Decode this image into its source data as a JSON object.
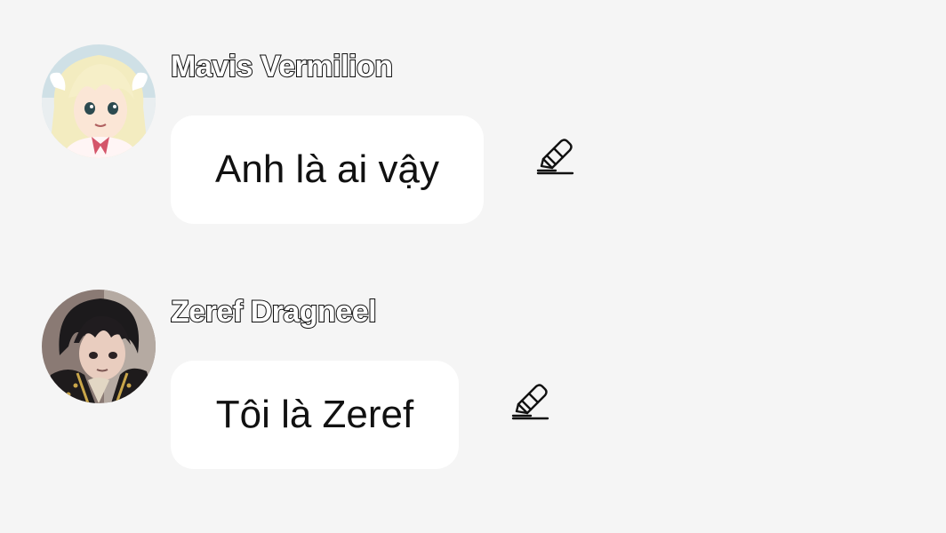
{
  "messages": [
    {
      "sender": "Mavis Vermilion",
      "text": "Anh là ai vậy",
      "avatar_icon": "mavis-avatar",
      "action_icon": "pencil-edit-icon"
    },
    {
      "sender": "Zeref Dragneel",
      "text": "Tôi là Zeref",
      "avatar_icon": "zeref-avatar",
      "action_icon": "pencil-edit-icon"
    }
  ],
  "colors": {
    "background": "#f5f5f5",
    "bubble": "#ffffff",
    "text": "#111111",
    "name_fill": "#ffffff",
    "name_outline": "#111111"
  }
}
